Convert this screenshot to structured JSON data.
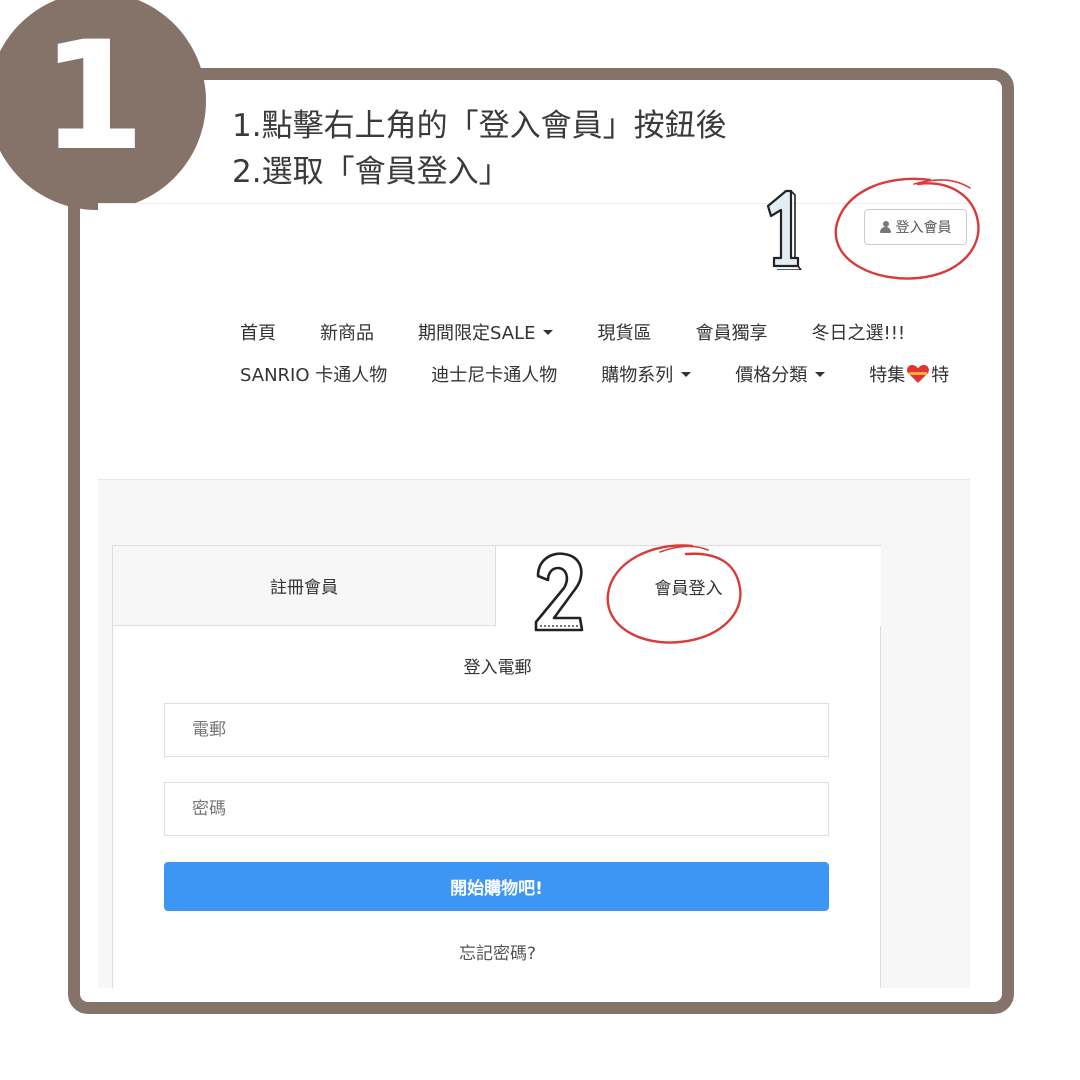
{
  "step": {
    "number": "1"
  },
  "instructions": {
    "line1": "1.點擊右上角的「登入會員」按鈕後",
    "line2": "2.選取「會員登入」"
  },
  "header": {
    "login_button_label": "登入會員"
  },
  "nav": {
    "row1": [
      "首頁",
      "新商品",
      "期間限定SALE",
      "現貨區",
      "會員獨享",
      "冬日之選!!!"
    ],
    "row2": [
      "SANRIO 卡通人物",
      "迪士尼卡通人物",
      "購物系列",
      "價格分類",
      "特集"
    ],
    "row2_last_tail": "特"
  },
  "tabs": {
    "register": "註冊會員",
    "login": "會員登入"
  },
  "login_form": {
    "heading": "登入電郵",
    "email_placeholder": "電郵",
    "password_placeholder": "密碼",
    "submit_label": "開始購物吧!",
    "forgot_label": "忘記密碼?"
  },
  "annotations": {
    "marker1": "1",
    "marker2": "2",
    "circle_color": "#d93a3a"
  },
  "colors": {
    "frame": "#857268",
    "primary_button": "#3d96f4"
  }
}
